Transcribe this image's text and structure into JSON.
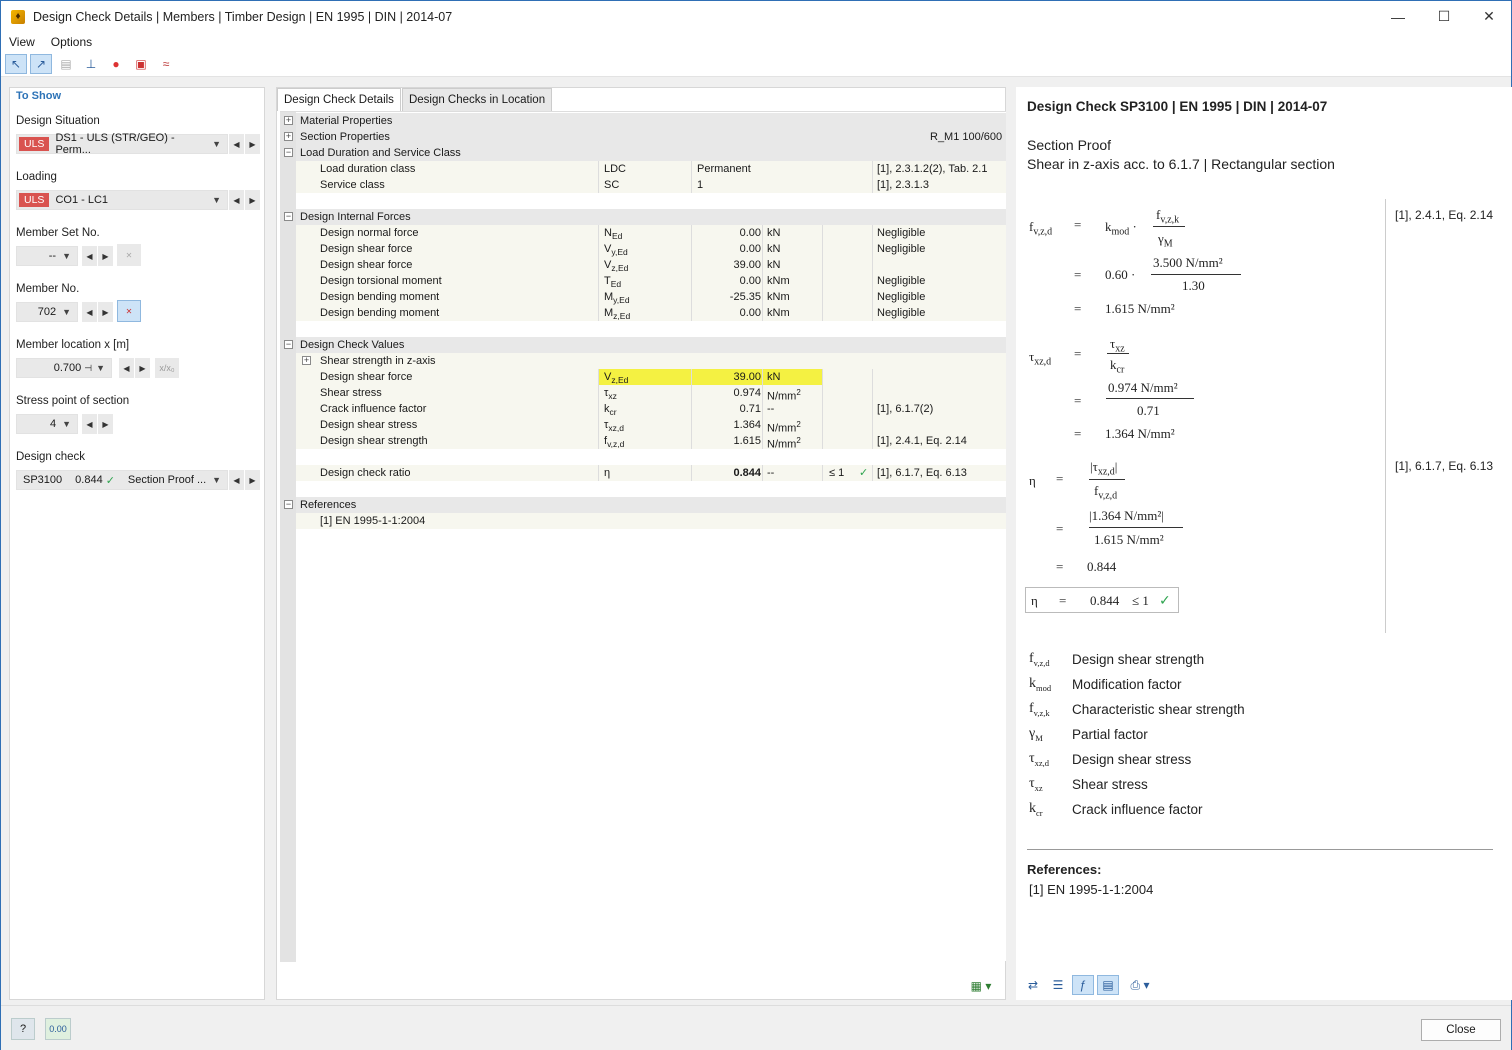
{
  "window": {
    "title": "Design Check Details | Members | Timber Design | EN 1995 | DIN | 2014-07",
    "app_icon": "timber-app-icon"
  },
  "menu": [
    "View",
    "Options"
  ],
  "left": {
    "header": "To Show",
    "design_situation_label": "Design Situation",
    "design_situation_tag": "ULS",
    "design_situation_value": "DS1 - ULS (STR/GEO) - Perm...",
    "loading_label": "Loading",
    "loading_tag": "ULS",
    "loading_value": "CO1 - LC1",
    "member_set_label": "Member Set No.",
    "member_set_value": "--",
    "member_label": "Member No.",
    "member_value": "702",
    "location_label": "Member location x [m]",
    "location_value": "0.700",
    "location_btn": "x/x₀",
    "stress_point_label": "Stress point of section",
    "stress_point_value": "4",
    "design_check_label": "Design check",
    "design_check_id": "SP3100",
    "design_check_ratio": "0.844",
    "design_check_type": "Section Proof ..."
  },
  "tabs": [
    "Design Check Details",
    "Design Checks in Location"
  ],
  "tree": {
    "material": "Material Properties",
    "section": "Section Properties",
    "section_value": "R_M1 100/600",
    "load_duration": "Load Duration and Service Class",
    "ld_rows": [
      {
        "label": "Load duration class",
        "sym": "LDC",
        "val": "Permanent",
        "ref": "[1], 2.3.1.2(2), Tab. 2.1"
      },
      {
        "label": "Service class",
        "sym": "SC",
        "val": "1",
        "ref": "[1], 2.3.1.3"
      }
    ],
    "forces": "Design Internal Forces",
    "force_rows": [
      {
        "label": "Design normal force",
        "sym": "NEd",
        "val": "0.00",
        "unit": "kN",
        "note": "Negligible"
      },
      {
        "label": "Design shear force",
        "sym": "Vy,Ed",
        "val": "0.00",
        "unit": "kN",
        "note": "Negligible"
      },
      {
        "label": "Design shear force",
        "sym": "Vz,Ed",
        "val": "39.00",
        "unit": "kN",
        "note": ""
      },
      {
        "label": "Design torsional moment",
        "sym": "TEd",
        "val": "0.00",
        "unit": "kNm",
        "note": "Negligible"
      },
      {
        "label": "Design bending moment",
        "sym": "My,Ed",
        "val": "-25.35",
        "unit": "kNm",
        "note": "Negligible"
      },
      {
        "label": "Design bending moment",
        "sym": "Mz,Ed",
        "val": "0.00",
        "unit": "kNm",
        "note": "Negligible"
      }
    ],
    "check_values": "Design Check Values",
    "shear_strength": "Shear strength in z-axis",
    "check_rows": [
      {
        "label": "Design shear force",
        "sym": "Vz,Ed",
        "val": "39.00",
        "unit": "kN",
        "ref": ""
      },
      {
        "label": "Shear stress",
        "sym": "τxz",
        "val": "0.974",
        "unit": "N/mm²",
        "ref": ""
      },
      {
        "label": "Crack influence factor",
        "sym": "kcr",
        "val": "0.71",
        "unit": "--",
        "ref": "[1], 6.1.7(2)"
      },
      {
        "label": "Design shear stress",
        "sym": "τxz,d",
        "val": "1.364",
        "unit": "N/mm²",
        "ref": ""
      },
      {
        "label": "Design shear strength",
        "sym": "fv,z,d",
        "val": "1.615",
        "unit": "N/mm²",
        "ref": "[1], 2.4.1, Eq. 2.14"
      }
    ],
    "ratio_row": {
      "label": "Design check ratio",
      "sym": "η",
      "val": "0.844",
      "unit": "--",
      "cond": "≤ 1",
      "ref": "[1], 6.1.7, Eq. 6.13"
    },
    "references": "References",
    "ref_item": "[1]  EN 1995-1-1:2004"
  },
  "right": {
    "title": "Design Check SP3100 | EN 1995 | DIN | 2014-07",
    "subtitle1": "Section Proof",
    "subtitle2": "Shear in z-axis acc. to 6.1.7 | Rectangular section",
    "ref1": "[1], 2.4.1, Eq. 2.14",
    "ref2": "[1], 6.1.7, Eq. 6.13",
    "kmod": "0.60",
    "fvzk": "3.500 N/mm²",
    "gm": "1.30",
    "fvzd": "1.615 N/mm²",
    "txz": "0.974 N/mm²",
    "kcr": "0.71",
    "txzd": "1.364 N/mm²",
    "abs_num": "|1.364 N/mm²|",
    "den": "1.615 N/mm²",
    "eta": "0.844",
    "eta_box": "0.844",
    "leq": "≤ 1",
    "legend": [
      {
        "sym": "fv,z,d",
        "desc": "Design shear strength"
      },
      {
        "sym": "kmod",
        "desc": "Modification factor"
      },
      {
        "sym": "fv,z,k",
        "desc": "Characteristic shear strength"
      },
      {
        "sym": "γM",
        "desc": "Partial factor"
      },
      {
        "sym": "τxz,d",
        "desc": "Design shear stress"
      },
      {
        "sym": "τxz",
        "desc": "Shear stress"
      },
      {
        "sym": "kcr",
        "desc": "Crack influence factor"
      }
    ],
    "refs_label": "References:",
    "refs_item": "[1]   EN 1995-1-1:2004"
  },
  "footer": {
    "close": "Close"
  }
}
